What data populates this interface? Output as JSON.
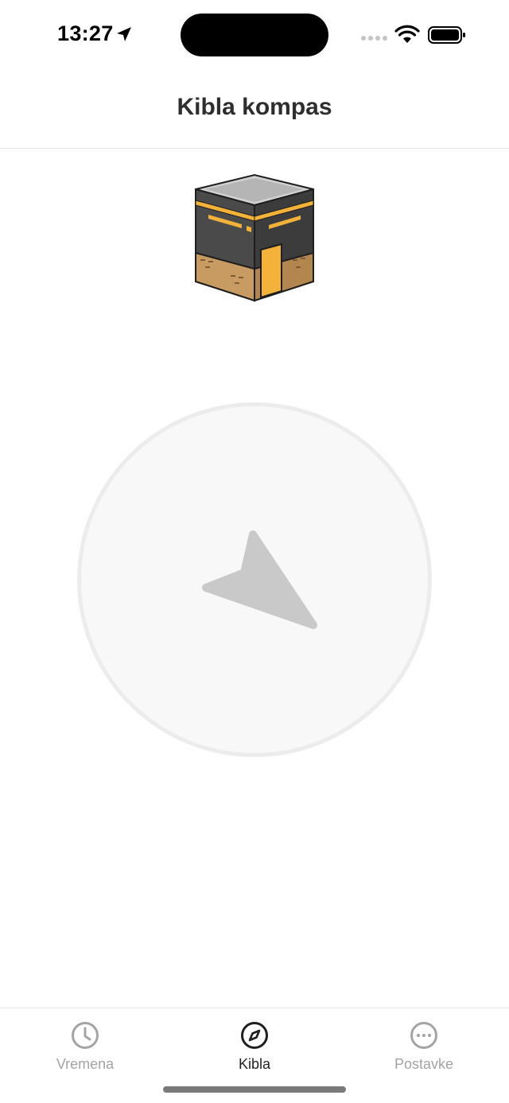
{
  "status_bar": {
    "time": "13:27",
    "icons": [
      "location-arrow-icon",
      "signal-dots-icon",
      "wifi-icon",
      "battery-icon"
    ]
  },
  "header": {
    "title": "Kibla kompas"
  },
  "kaaba": {
    "icon": "kaaba-icon",
    "colors": {
      "stone": "#4a4a4a",
      "gold": "#f5b23a",
      "base": "#c89b63",
      "roof": "#b5b5b5"
    }
  },
  "compass": {
    "dial_color": "#f8f8f8",
    "ring_color": "#ececec",
    "arrow_color": "#c9c9c9",
    "arrow_heading_deg": 150
  },
  "tab_bar": {
    "tabs": [
      {
        "label": "Vremena",
        "icon": "clock-icon",
        "active": false
      },
      {
        "label": "Kibla",
        "icon": "compass-icon",
        "active": true
      },
      {
        "label": "Postavke",
        "icon": "more-icon",
        "active": false
      }
    ],
    "active_color": "#1f1f1f",
    "inactive_color": "#a4a4a4"
  }
}
